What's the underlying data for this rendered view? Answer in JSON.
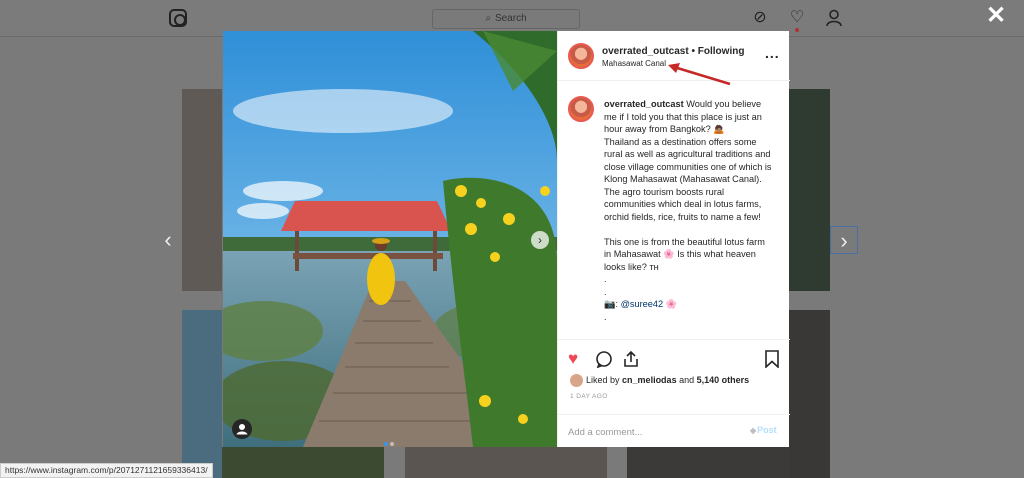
{
  "app": {
    "search_placeholder": "Search",
    "close_label": "✕"
  },
  "post": {
    "username": "overrated_outcast",
    "separator": "•",
    "follow_label": "Following",
    "location": "Mahasawat Canal",
    "more_label": "...",
    "caption_user": "overrated_outcast",
    "caption_text": "Would you believe me if I told you that this place is just an hour away from Bangkok? 🙇🏽\nThailand as a destination offers some rural as well as agricultural traditions and close village communities one of which is Klong Mahasawat (Mahasawat Canal). The agro tourism boosts rural communities which deal in lotus farms, orchid fields, rice, fruits to name a few!",
    "caption_text2": "This one is from the beautiful lotus farm in Mahasawat 🌸 Is this what heaven looks like? ᴛʜ\n.\n.",
    "credit_prefix": "📷:",
    "credit_mention": "@suree42",
    "credit_suffix": "🌸",
    "caption_tail": ".",
    "liked_by_prefix": "Liked by",
    "liked_by_user": "cn_meliodas",
    "liked_by_and": "and",
    "liked_by_count": "5,140 others",
    "time_ago": "1 DAY AGO",
    "comment_placeholder": "Add a comment...",
    "post_label": "Post"
  },
  "icons": {
    "heart": "♥",
    "comment": "◯",
    "share": "⇪",
    "bookmark": "▯"
  },
  "status_bar": {
    "url": "https://www.instagram.com/p/2071271121659336413/"
  },
  "colors": {
    "accent": "#3897f0",
    "heart": "#ed4956",
    "annotation_arrow": "#c62828"
  }
}
